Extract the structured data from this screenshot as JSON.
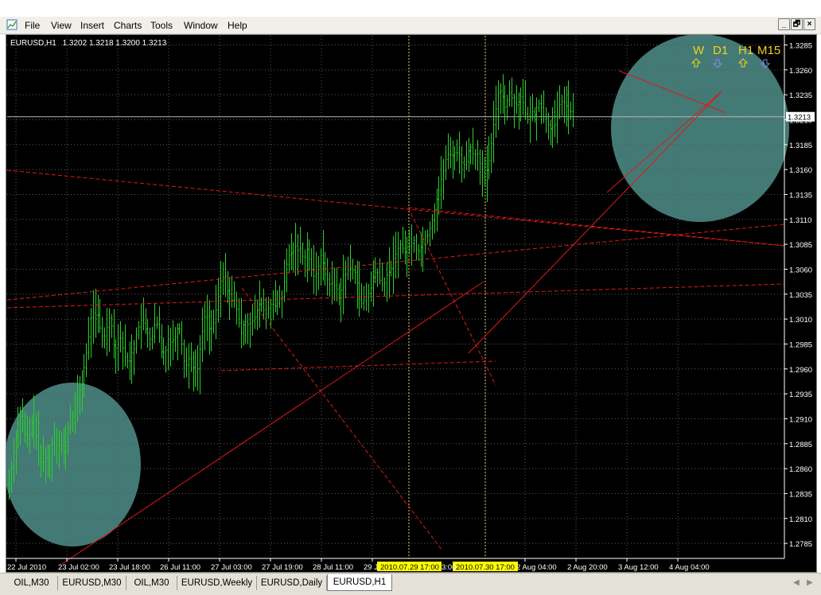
{
  "menu": {
    "items": [
      "File",
      "View",
      "Insert",
      "Charts",
      "Tools",
      "Window",
      "Help"
    ],
    "window_buttons": [
      "_",
      "🗗",
      "×"
    ]
  },
  "chart_info": {
    "symbol": "EURUSD,H1",
    "ohlc": "1.3202 1.3218 1.3200 1.3213"
  },
  "signals": {
    "labels": [
      "W",
      "D1",
      "H1",
      "M15"
    ],
    "arrows": [
      "up",
      "down",
      "up",
      "down"
    ],
    "colors": {
      "label": "#f2d21d",
      "up": "#f2d21d",
      "down": "#8d86e8"
    }
  },
  "colors": {
    "bars": "#29d12a",
    "trendlines": "#e01919",
    "grid": "#5a5a5a",
    "axis_text": "#ffffff",
    "highlight_circle": "#4f8f8a",
    "date_marker_bg": "#ffff00",
    "vline": "#e6d26c"
  },
  "chart_data": {
    "type": "ohlc",
    "y_ticks": [
      "1.3285",
      "1.3260",
      "1.3235",
      "1.3210",
      "1.3185",
      "1.3160",
      "1.3135",
      "1.3110",
      "1.3085",
      "1.3060",
      "1.3035",
      "1.3010",
      "1.2985",
      "1.2960",
      "1.2935",
      "1.2910",
      "1.2885",
      "1.2860",
      "1.2835",
      "1.2810",
      "1.2785"
    ],
    "ylim": [
      1.2775,
      1.33
    ],
    "current_price": "1.3213",
    "x_ticks": [
      "22 Jul 2010",
      "23 Jul 02:00",
      "23 Jul 18:00",
      "26 Jul 11:00",
      "27 Jul 03:00",
      "27 Jul 19:00",
      "28 Jul 11:00",
      "29 J",
      "2 Aug 04:00",
      "2 Aug 20:00",
      "3 Aug 12:00",
      "4 Aug 04:00"
    ],
    "date_markers": [
      "2010.07.29 17:00",
      "2010.07.30 17:00"
    ],
    "marker_fragment": "3:00",
    "n_bars": 300,
    "closes": [
      1.2845,
      1.2861,
      1.2877,
      1.2893,
      1.2905,
      1.2912,
      1.2902,
      1.2895,
      1.2889,
      1.2895,
      1.2906,
      1.2909,
      1.2893,
      1.2871,
      1.2867,
      1.2874,
      1.2871,
      1.2861,
      1.2868,
      1.2885,
      1.2895,
      1.2889,
      1.2883,
      1.2883,
      1.2877,
      1.2883,
      1.29,
      1.291,
      1.2913,
      1.2918,
      1.2929,
      1.2939,
      1.2945,
      1.2961,
      1.2976,
      1.2992,
      1.3011,
      1.3016,
      1.3014,
      1.3014,
      1.3001,
      1.2993,
      1.2993,
      1.3002,
      1.3011,
      1.3003,
      1.2984,
      1.2981,
      1.2991,
      1.2991,
      1.2981,
      1.2972,
      1.2968,
      1.2968,
      1.2976,
      1.298,
      1.2994,
      1.3002,
      1.3009,
      1.3006,
      1.3,
      1.2996,
      1.299,
      1.2993,
      1.3004,
      1.3005,
      1.2992,
      1.2977,
      1.2977,
      1.2979,
      1.299,
      1.2987,
      1.2989,
      1.2992,
      1.3,
      1.3,
      1.2985,
      1.2968,
      1.2964,
      1.297,
      1.2971,
      1.2961,
      1.2957,
      1.296,
      1.298,
      1.2998,
      1.3012,
      1.3013,
      1.3,
      1.3001,
      1.3006,
      1.3019,
      1.3033,
      1.3048,
      1.3052,
      1.3053,
      1.3038,
      1.3035,
      1.3029,
      1.3029,
      1.302,
      1.3006,
      1.2996,
      1.3004,
      1.3007,
      1.3005,
      1.3006,
      1.3008,
      1.3012,
      1.3018,
      1.3025,
      1.3026,
      1.3019,
      1.3015,
      1.3021,
      1.3025,
      1.3025,
      1.3023,
      1.3026,
      1.3031,
      1.3032,
      1.3047,
      1.3065,
      1.3074,
      1.3076,
      1.3078,
      1.3083,
      1.3079,
      1.3081,
      1.3073,
      1.3072,
      1.308,
      1.307,
      1.306,
      1.3053,
      1.3056,
      1.3063,
      1.3074,
      1.3066,
      1.3055,
      1.305,
      1.3045,
      1.3046,
      1.3044,
      1.304,
      1.3031,
      1.3039,
      1.3054,
      1.3055,
      1.3059,
      1.3061,
      1.3059,
      1.3057,
      1.3046,
      1.303,
      1.3026,
      1.3029,
      1.3032,
      1.3036,
      1.3041,
      1.3052,
      1.3057,
      1.3057,
      1.3049,
      1.3044,
      1.3046,
      1.3054,
      1.3057,
      1.3061,
      1.3071,
      1.3075,
      1.3081,
      1.3085,
      1.3081,
      1.3077,
      1.3082,
      1.3083,
      1.3086,
      1.3089,
      1.308,
      1.3078,
      1.3082,
      1.3087,
      1.3093,
      1.3094,
      1.3101,
      1.3109,
      1.312,
      1.313,
      1.3139,
      1.315,
      1.3159,
      1.317,
      1.3175,
      1.3175,
      1.3174,
      1.3177,
      1.3177,
      1.3175,
      1.3167,
      1.3165,
      1.3168,
      1.3179,
      1.3182,
      1.3176,
      1.3175,
      1.3176,
      1.3166,
      1.3152,
      1.3149,
      1.3159,
      1.3169,
      1.3186,
      1.3205,
      1.3221,
      1.3237,
      1.3239,
      1.3233,
      1.3223,
      1.3229,
      1.3237,
      1.3232,
      1.3227,
      1.3225,
      1.3228,
      1.3233,
      1.3227,
      1.3216,
      1.321,
      1.3213,
      1.3218,
      1.3215,
      1.3222,
      1.3226,
      1.3222,
      1.3213,
      1.3211,
      1.3205,
      1.3201,
      1.3203,
      1.3205,
      1.3215,
      1.3225,
      1.3228,
      1.3227,
      1.3224,
      1.3219,
      1.3218,
      1.3213
    ]
  },
  "tabs": [
    "OIL,M30",
    "EURUSD,M30",
    "OIL,M30",
    "EURUSD,Weekly",
    "EURUSD,Daily",
    "EURUSD,H1"
  ],
  "tab_nav": [
    "◀",
    "▶"
  ]
}
